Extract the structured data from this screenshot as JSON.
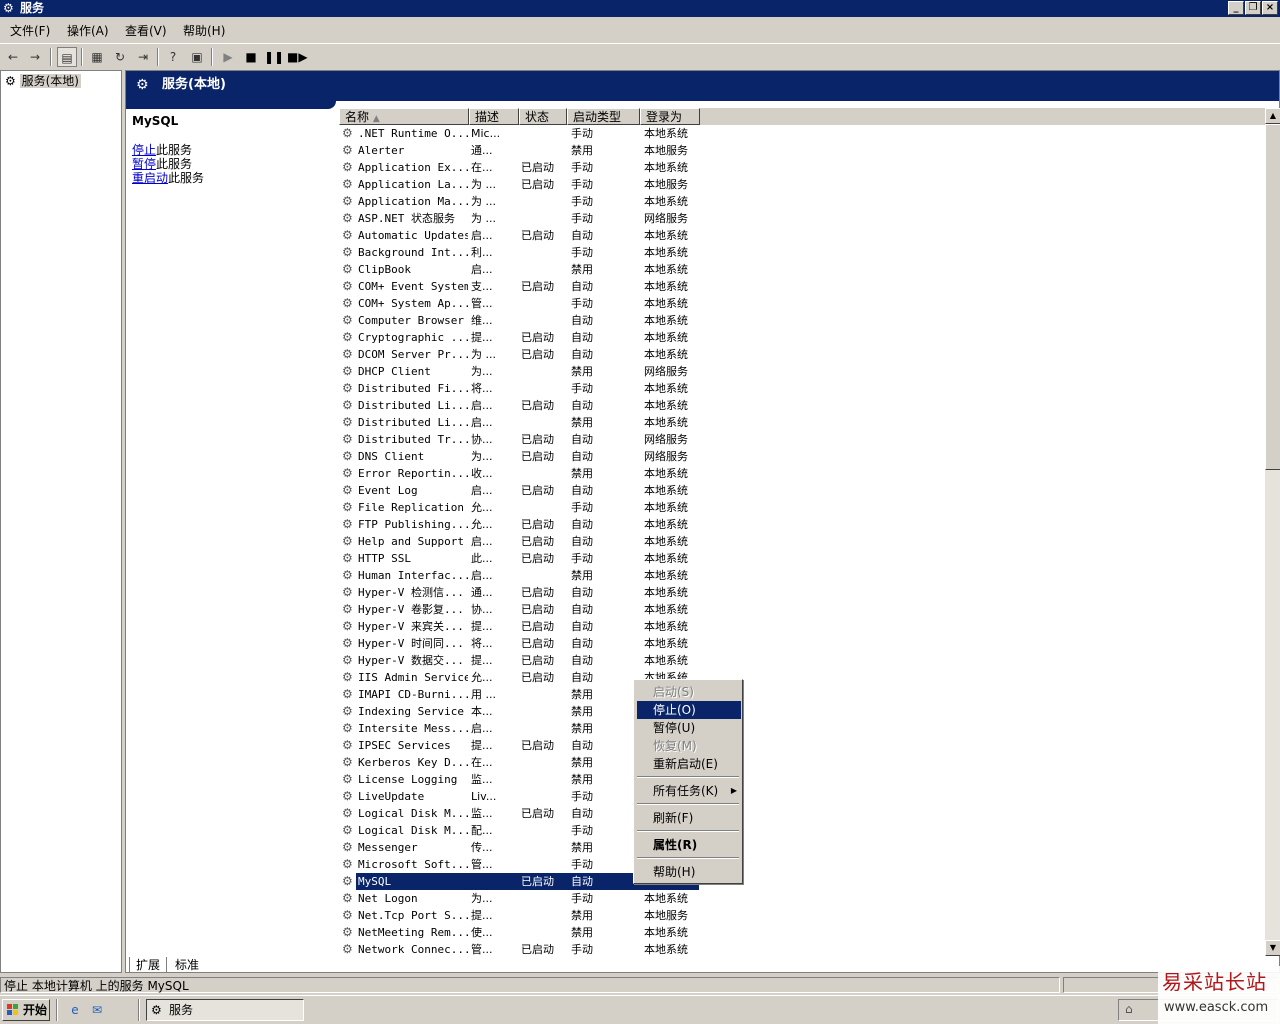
{
  "window": {
    "title": "服务"
  },
  "menu": [
    "文件(F)",
    "操作(A)",
    "查看(V)",
    "帮助(H)"
  ],
  "tree": {
    "root_label": "服务(本地)"
  },
  "panel": {
    "header": "服务(本地)",
    "selected_service": "MySQL",
    "links": [
      {
        "link": "停止",
        "rest": "此服务"
      },
      {
        "link": "暂停",
        "rest": "此服务"
      },
      {
        "link": "重启动",
        "rest": "此服务"
      }
    ]
  },
  "columns": [
    "名称",
    "描述",
    "状态",
    "启动类型",
    "登录为"
  ],
  "services": [
    [
      ".NET Runtime O...",
      "Mic...",
      "",
      "手动",
      "本地系统"
    ],
    [
      "Alerter",
      "通...",
      "",
      "禁用",
      "本地服务"
    ],
    [
      "Application Ex...",
      "在...",
      "已启动",
      "手动",
      "本地系统"
    ],
    [
      "Application La...",
      "为 ...",
      "已启动",
      "手动",
      "本地服务"
    ],
    [
      "Application Ma...",
      "为 ...",
      "",
      "手动",
      "本地系统"
    ],
    [
      "ASP.NET 状态服务",
      "为 ...",
      "",
      "手动",
      "网络服务"
    ],
    [
      "Automatic Updates",
      "启...",
      "已启动",
      "自动",
      "本地系统"
    ],
    [
      "Background Int...",
      "利...",
      "",
      "手动",
      "本地系统"
    ],
    [
      "ClipBook",
      "启...",
      "",
      "禁用",
      "本地系统"
    ],
    [
      "COM+ Event System",
      "支...",
      "已启动",
      "自动",
      "本地系统"
    ],
    [
      "COM+ System Ap...",
      "管...",
      "",
      "手动",
      "本地系统"
    ],
    [
      "Computer Browser",
      "维...",
      "",
      "自动",
      "本地系统"
    ],
    [
      "Cryptographic ...",
      "提...",
      "已启动",
      "自动",
      "本地系统"
    ],
    [
      "DCOM Server Pr...",
      "为 ...",
      "已启动",
      "自动",
      "本地系统"
    ],
    [
      "DHCP Client",
      "为...",
      "",
      "禁用",
      "网络服务"
    ],
    [
      "Distributed Fi...",
      "将...",
      "",
      "手动",
      "本地系统"
    ],
    [
      "Distributed Li...",
      "启...",
      "已启动",
      "自动",
      "本地系统"
    ],
    [
      "Distributed Li...",
      "启...",
      "",
      "禁用",
      "本地系统"
    ],
    [
      "Distributed Tr...",
      "协...",
      "已启动",
      "自动",
      "网络服务"
    ],
    [
      "DNS Client",
      "为...",
      "已启动",
      "自动",
      "网络服务"
    ],
    [
      "Error Reportin...",
      "收...",
      "",
      "禁用",
      "本地系统"
    ],
    [
      "Event Log",
      "启...",
      "已启动",
      "自动",
      "本地系统"
    ],
    [
      "File Replication",
      "允...",
      "",
      "手动",
      "本地系统"
    ],
    [
      "FTP Publishing...",
      "允...",
      "已启动",
      "自动",
      "本地系统"
    ],
    [
      "Help and Support",
      "启...",
      "已启动",
      "自动",
      "本地系统"
    ],
    [
      "HTTP SSL",
      "此...",
      "已启动",
      "手动",
      "本地系统"
    ],
    [
      "Human Interfac...",
      "启...",
      "",
      "禁用",
      "本地系统"
    ],
    [
      "Hyper-V 检测信...",
      "通...",
      "已启动",
      "自动",
      "本地系统"
    ],
    [
      "Hyper-V 卷影复...",
      "协...",
      "已启动",
      "自动",
      "本地系统"
    ],
    [
      "Hyper-V 来宾关...",
      "提...",
      "已启动",
      "自动",
      "本地系统"
    ],
    [
      "Hyper-V 时间同...",
      "将...",
      "已启动",
      "自动",
      "本地系统"
    ],
    [
      "Hyper-V 数据交...",
      "提...",
      "已启动",
      "自动",
      "本地系统"
    ],
    [
      "IIS Admin Service",
      "允...",
      "已启动",
      "自动",
      "本地系统"
    ],
    [
      "IMAPI CD-Burni...",
      "用 ...",
      "",
      "禁用",
      ""
    ],
    [
      "Indexing Service",
      "本...",
      "",
      "禁用",
      ""
    ],
    [
      "Intersite Mess...",
      "启...",
      "",
      "禁用",
      ""
    ],
    [
      "IPSEC Services",
      "提...",
      "已启动",
      "自动",
      ""
    ],
    [
      "Kerberos Key D...",
      "在...",
      "",
      "禁用",
      ""
    ],
    [
      "License Logging",
      "监...",
      "",
      "禁用",
      ""
    ],
    [
      "LiveUpdate",
      "Liv...",
      "",
      "手动",
      ""
    ],
    [
      "Logical Disk M...",
      "监...",
      "已启动",
      "自动",
      ""
    ],
    [
      "Logical Disk M...",
      "配...",
      "",
      "手动",
      ""
    ],
    [
      "Messenger",
      "传...",
      "",
      "禁用",
      ""
    ],
    [
      "Microsoft Soft...",
      "管...",
      "",
      "手动",
      ""
    ],
    [
      "MySQL",
      "",
      "已启动",
      "自动",
      ""
    ],
    [
      "Net Logon",
      "为...",
      "",
      "手动",
      "本地系统"
    ],
    [
      "Net.Tcp Port S...",
      "提...",
      "",
      "禁用",
      "本地服务"
    ],
    [
      "NetMeeting Rem...",
      "使...",
      "",
      "禁用",
      "本地系统"
    ],
    [
      "Network Connec...",
      "管...",
      "已启动",
      "手动",
      "本地系统"
    ]
  ],
  "context_menu": {
    "start": "启动(S)",
    "stop": "停止(O)",
    "pause": "暂停(U)",
    "resume": "恢复(M)",
    "restart": "重新启动(E)",
    "all_tasks": "所有任务(K)",
    "refresh": "刷新(F)",
    "properties": "属性(R)",
    "help": "帮助(H)"
  },
  "tabs": [
    "扩展",
    "标准"
  ],
  "statusbar": {
    "text": "停止 本地计算机 上的服务 MySQL"
  },
  "taskbar": {
    "start": "开始",
    "task": "服务"
  },
  "watermark": {
    "line1": "易采站长站",
    "line2": "www.easck.com"
  }
}
